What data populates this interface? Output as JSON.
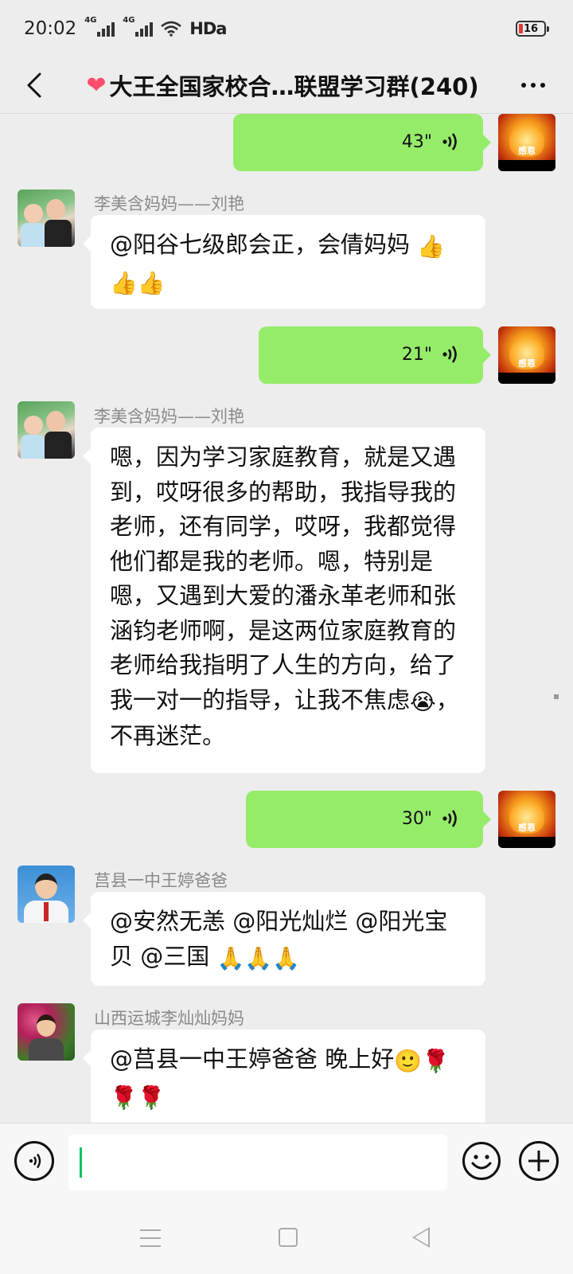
{
  "status_bar": {
    "time": "20:02",
    "signal1": "4G",
    "signal2": "4G",
    "hd": "HDa",
    "battery": "16"
  },
  "header": {
    "back_icon": "chevron-left-icon",
    "heart_icon": "❤",
    "title": "大王全国家校合…联盟学习群(240)",
    "more_icon": "more-dots-icon"
  },
  "messages": [
    {
      "type": "voice_out",
      "duration": "43\""
    },
    {
      "type": "text_in",
      "sender": "李美含妈妈——刘艳",
      "text": "@阳谷七级郎会正，会倩妈妈 ",
      "emojis": [
        "👍",
        "👍",
        "👍"
      ]
    },
    {
      "type": "voice_out",
      "duration": "21\""
    },
    {
      "type": "text_in",
      "sender": "李美含妈妈——刘艳",
      "text": "嗯，因为学习家庭教育，就是又遇到，哎呀很多的帮助，我指导我的老师，还有同学，哎呀，我都觉得他们都是我的老师。嗯，特别是嗯，又遇到大爱的潘永革老师和张涵钧老师啊，是这两位家庭教育的老师给我指明了人生的方向，给了我一对一的指导，让我不焦虑",
      "emoji": "😭",
      "text_after": "，不再迷茫。"
    },
    {
      "type": "voice_out",
      "duration": "30\""
    },
    {
      "type": "text_in",
      "sender": "莒县一中王婷爸爸",
      "text": "@安然无恙 @阳光灿烂 @阳光宝贝 @三国 ",
      "emojis": [
        "🙏",
        "🙏",
        "🙏"
      ]
    },
    {
      "type": "text_in",
      "sender": "山西运城李灿灿妈妈",
      "text": "@莒县一中王婷爸爸  晚上好",
      "emojis": [
        "🙂",
        "🌹",
        "🌹",
        "🌹"
      ]
    }
  ],
  "my_avatar_label": "感恩",
  "input_bar": {
    "voice_icon": "voice-input-icon",
    "emoji_icon": "emoji-smile-icon",
    "plus_icon": "plus-circle-icon"
  },
  "colors": {
    "bubble_out": "#95ec69",
    "bubble_in": "#ffffff",
    "background": "#ededed",
    "caret": "#07c160"
  }
}
